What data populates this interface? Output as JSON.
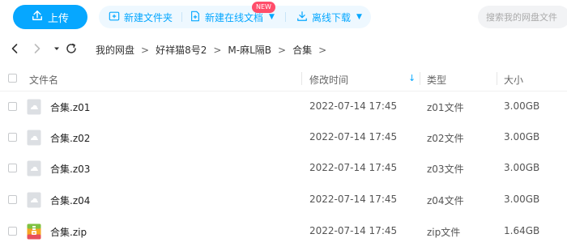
{
  "toolbar": {
    "upload_label": "上传",
    "new_folder_label": "新建文件夹",
    "new_online_doc_label": "新建在线文档",
    "new_badge": "NEW",
    "offline_download_label": "离线下载",
    "search_placeholder": "搜索我的网盘文件"
  },
  "breadcrumb": [
    "我的网盘",
    "好祥猫8号2",
    "M-麻L隔B",
    "合集"
  ],
  "table": {
    "headers": {
      "name": "文件名",
      "modified": "修改时间",
      "type": "类型",
      "size": "大小"
    },
    "sort_indicator": "↓",
    "rows": [
      {
        "name": "合集.z01",
        "modified": "2022-07-14 17:45",
        "type": "z01文件",
        "size": "3.00GB",
        "icon": "generic-file-icon"
      },
      {
        "name": "合集.z02",
        "modified": "2022-07-14 17:45",
        "type": "z02文件",
        "size": "3.00GB",
        "icon": "generic-file-icon"
      },
      {
        "name": "合集.z03",
        "modified": "2022-07-14 17:45",
        "type": "z03文件",
        "size": "3.00GB",
        "icon": "generic-file-icon"
      },
      {
        "name": "合集.z04",
        "modified": "2022-07-14 17:45",
        "type": "z04文件",
        "size": "3.00GB",
        "icon": "generic-file-icon"
      },
      {
        "name": "合集.zip",
        "modified": "2022-07-14 17:45",
        "type": "zip文件",
        "size": "1.64GB",
        "icon": "zip-archive-icon"
      }
    ]
  },
  "colors": {
    "accent": "#06a7ff",
    "toolbar_group_bg": "#eef8ff",
    "badge": "#ff4d6a"
  }
}
